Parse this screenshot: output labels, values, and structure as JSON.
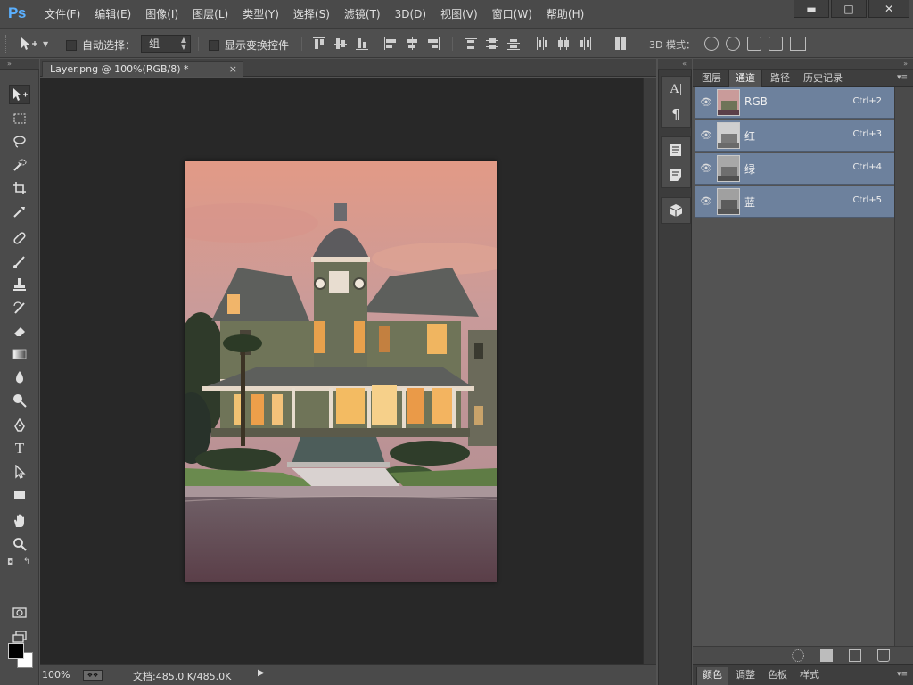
{
  "app": {
    "logo": "Ps"
  },
  "menu": [
    {
      "label": "文件(F)"
    },
    {
      "label": "编辑(E)"
    },
    {
      "label": "图像(I)"
    },
    {
      "label": "图层(L)"
    },
    {
      "label": "类型(Y)"
    },
    {
      "label": "选择(S)"
    },
    {
      "label": "滤镜(T)"
    },
    {
      "label": "3D(D)"
    },
    {
      "label": "视图(V)"
    },
    {
      "label": "窗口(W)"
    },
    {
      "label": "帮助(H)"
    }
  ],
  "window_controls": {
    "minimize": "▬",
    "maximize": "□",
    "close": "✕"
  },
  "options": {
    "auto_select_label": "自动选择：",
    "auto_select_value": "组",
    "show_transform_label": "显示变换控件",
    "mode_3d_label": "3D 模式："
  },
  "document": {
    "tab_title": "Layer.png @ 100%(RGB/8) *",
    "tab_close": "×"
  },
  "status": {
    "zoom": "100%",
    "doc_info": "文档:485.0 K/485.0K",
    "arrow": "▶"
  },
  "panel_tabs": [
    {
      "label": "图层",
      "active": false
    },
    {
      "label": "通道",
      "active": true
    },
    {
      "label": "路径",
      "active": false
    },
    {
      "label": "历史记录",
      "active": false
    }
  ],
  "channels": [
    {
      "name": "RGB",
      "shortcut": "Ctrl+2"
    },
    {
      "name": "红",
      "shortcut": "Ctrl+3"
    },
    {
      "name": "绿",
      "shortcut": "Ctrl+4"
    },
    {
      "name": "蓝",
      "shortcut": "Ctrl+5"
    }
  ],
  "bottom_tabs": [
    {
      "label": "颜色",
      "active": true
    },
    {
      "label": "调整",
      "active": false
    },
    {
      "label": "色板",
      "active": false
    },
    {
      "label": "样式",
      "active": false
    }
  ],
  "colors": {
    "accent": "#5bb0ff",
    "channel_row": "#6d819d",
    "foreground": "#000000",
    "background": "#ffffff"
  }
}
